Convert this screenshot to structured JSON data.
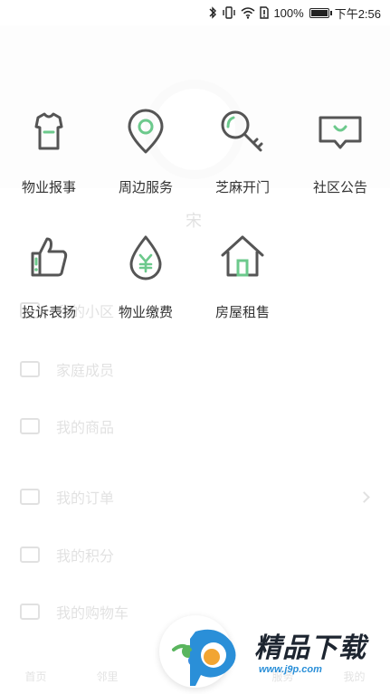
{
  "status_bar": {
    "battery_percent": "100%",
    "time": "下午2:56",
    "battery_level": 1.0
  },
  "background": {
    "username": "宋",
    "rows": [
      {
        "label": "我的小区",
        "icon": "building-icon"
      },
      {
        "label": "家庭成员",
        "icon": "family-icon"
      },
      {
        "label": "我的商品",
        "icon": "goods-icon"
      },
      {
        "label": "我的订单",
        "icon": "order-icon"
      },
      {
        "label": "我的积分",
        "icon": "points-icon"
      },
      {
        "label": "我的购物车",
        "icon": "cart-icon"
      }
    ],
    "tabs": [
      "首页",
      "邻里",
      "",
      "服务",
      "我的"
    ]
  },
  "menu": {
    "items": [
      {
        "label": "物业报事",
        "icon": "property-report-icon"
      },
      {
        "label": "周边服务",
        "icon": "location-pin-icon"
      },
      {
        "label": "芝麻开门",
        "icon": "key-icon"
      },
      {
        "label": "社区公告",
        "icon": "announcement-icon"
      },
      {
        "label": "投诉表扬",
        "icon": "thumbs-up-icon"
      },
      {
        "label": "物业缴费",
        "icon": "payment-drop-icon"
      },
      {
        "label": "房屋租售",
        "icon": "house-icon"
      }
    ]
  },
  "watermark": {
    "brand": "精品下载",
    "url": "www.j9p.com"
  },
  "colors": {
    "accent": "#6cc98c",
    "icon_stroke": "#555555",
    "text": "#333333"
  }
}
